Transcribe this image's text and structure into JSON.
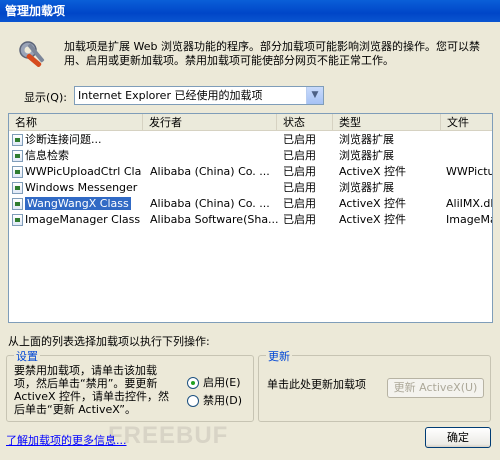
{
  "window": {
    "title": "管理加载项"
  },
  "description": "加载项是扩展 Web 浏览器功能的程序。部分加载项可能影响浏览器的操作。您可以禁用、启用或更新加载项。禁用加载项可能使部分网页不能正常工作。",
  "show": {
    "label": "显示(Q):",
    "value": "Internet Explorer 已经使用的加载项"
  },
  "list": {
    "columns": [
      "名称",
      "发行者",
      "状态",
      "类型",
      "文件"
    ],
    "rows": [
      {
        "name": "诊断连接问题...",
        "publisher": "",
        "status": "已启用",
        "type": "浏览器扩展",
        "file": ""
      },
      {
        "name": "信息检索",
        "publisher": "",
        "status": "已启用",
        "type": "浏览器扩展",
        "file": ""
      },
      {
        "name": "WWPicUploadCtrl Class",
        "publisher": "Alibaba (China) Co. ...",
        "status": "已启用",
        "type": "ActiveX 控件",
        "file": "WWPictur..."
      },
      {
        "name": "Windows Messenger",
        "publisher": "",
        "status": "已启用",
        "type": "浏览器扩展",
        "file": ""
      },
      {
        "name": "WangWangX Class",
        "publisher": "Alibaba (China) Co. ...",
        "status": "已启用",
        "type": "ActiveX 控件",
        "file": "AliIMX.dl"
      },
      {
        "name": "ImageManager Class",
        "publisher": "Alibaba Software(Sha...",
        "status": "已启用",
        "type": "ActiveX 控件",
        "file": "ImageMan..."
      }
    ]
  },
  "ops_label": "从上面的列表选择加载项以执行下列操作:",
  "settings": {
    "title": "设置",
    "text": "要禁用加载项，请单击该加载项，然后单击“禁用”。要更新 ActiveX 控件，请单击控件，然后单击“更新 ActiveX”。",
    "enable_label": "启用(E)",
    "disable_label": "禁用(D)"
  },
  "update": {
    "title": "更新",
    "text": "单击此处更新加载项",
    "button_label": "更新 ActiveX(U)"
  },
  "more_link": "了解加载项的更多信息...",
  "watermark": "FREEBUF",
  "ok_label": "确定"
}
